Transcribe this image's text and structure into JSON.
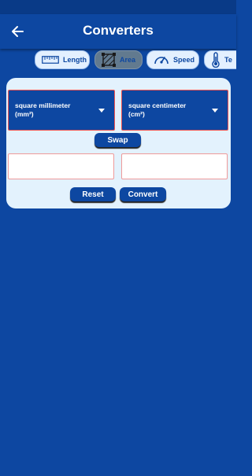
{
  "app_bar": {
    "title": "Converters",
    "back_icon": "arrow-left-icon"
  },
  "tabs": [
    {
      "label": "Length",
      "icon": "ruler-icon",
      "active": false
    },
    {
      "label": "Area",
      "icon": "area-icon",
      "active": true
    },
    {
      "label": "Speed",
      "icon": "speedometer-icon",
      "active": false
    },
    {
      "label": "Te",
      "icon": "thermometer-icon",
      "active": false
    }
  ],
  "converter": {
    "from_unit": {
      "line1": "square millimeter",
      "line2": "(mm²)"
    },
    "to_unit": {
      "line1": "square centimeter",
      "line2": "(cm²)"
    },
    "swap_label": "Swap",
    "input_value": "",
    "output_value": "",
    "reset_label": "Reset",
    "convert_label": "Convert"
  },
  "colors": {
    "background": "#0d47a1",
    "card": "#e3f2fd",
    "tab_bg": "#e3f0ff",
    "active_tab_bg": "#627a8f",
    "dropdown_border": "#ef5350"
  }
}
